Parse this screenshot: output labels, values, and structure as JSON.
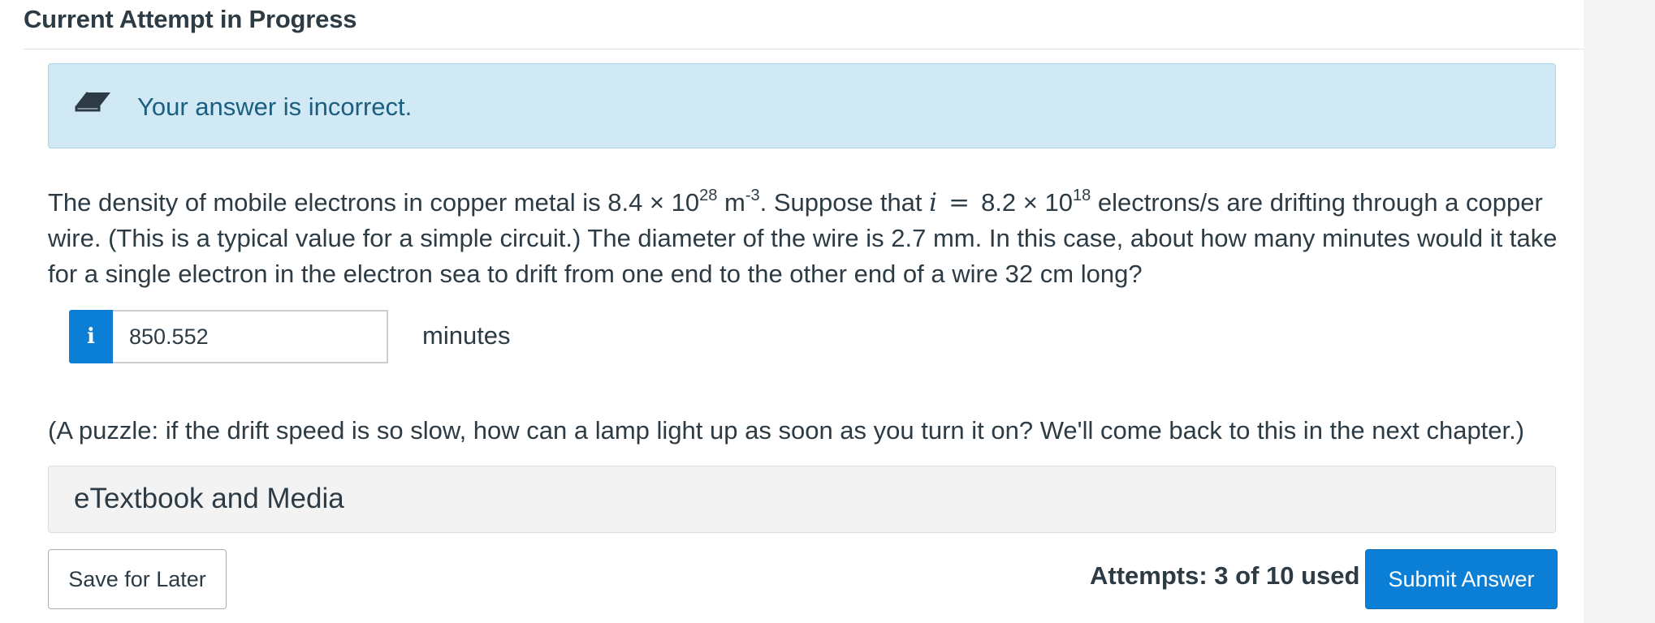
{
  "header": {
    "title": "Current Attempt in Progress"
  },
  "alert": {
    "icon": "eraser-icon",
    "message": "Your answer is incorrect.",
    "colors": {
      "background": "#d1e9f4",
      "text": "#1b5e80"
    }
  },
  "question": {
    "p1": "The density of mobile electrons in copper metal is 8.4 × 10",
    "exp1": "28",
    "p2": " m",
    "exp2": "-3",
    "p3": ". Suppose that ",
    "var": "i",
    "eq": "=",
    "p4": "8.2 × 10",
    "exp3": "18",
    "p5": " electrons/s are drifting through a copper wire. (This is a typical value for a simple circuit.) The diameter of the wire is 2.7 mm. In this case, about how many minutes would it take for a single electron in the electron sea to drift from one end to the other end of a wire 32 cm long?"
  },
  "answer": {
    "info_icon_label": "i",
    "value": "850.552",
    "unit": "minutes"
  },
  "puzzle_text": "(A puzzle: if the drift speed is so slow, how can a lamp light up as soon as you turn it on? We'll come back to this in the next chapter.)",
  "etextbook": {
    "label": "eTextbook and Media"
  },
  "footer": {
    "save_label": "Save for Later",
    "attempts": "Attempts: 3 of 10 used",
    "submit_label": "Submit Answer",
    "submit_color": "#0b7fd6"
  }
}
